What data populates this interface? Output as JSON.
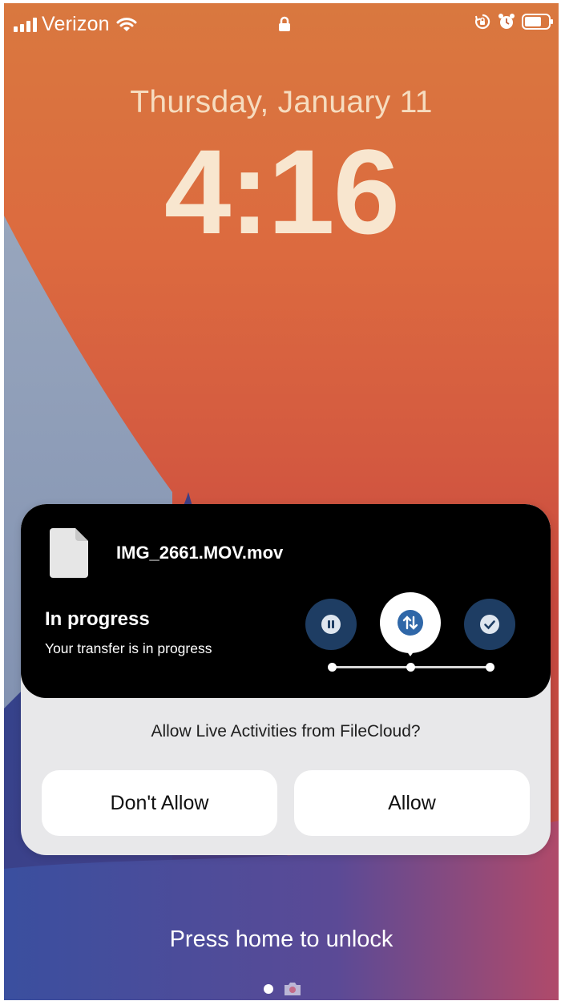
{
  "status_bar": {
    "carrier": "Verizon",
    "signal_bars": 4,
    "icons": [
      "signal-icon",
      "wifi-icon",
      "lock-icon",
      "rotation-lock-icon",
      "alarm-icon",
      "battery-icon"
    ]
  },
  "lock_screen": {
    "date": "Thursday, January 11",
    "time": "4:16",
    "unlock_hint": "Press home to unlock",
    "page_indicator": [
      "page-dot",
      "camera-icon"
    ]
  },
  "live_activity": {
    "filename": "IMG_2661.MOV.mov",
    "status_title": "In progress",
    "status_subtitle": "Your transfer is in progress",
    "steps": [
      {
        "name": "pause",
        "icon": "pause-icon",
        "active": false
      },
      {
        "name": "transfer",
        "icon": "transfer-arrows-icon",
        "active": true
      },
      {
        "name": "complete",
        "icon": "checkmark-icon",
        "active": false
      }
    ],
    "colors": {
      "step_bg": "#1e3d63",
      "step_icon": "#2f67a8",
      "card_bg": "#000000"
    }
  },
  "permission": {
    "prompt": "Allow Live Activities from FileCloud?",
    "deny_label": "Don't Allow",
    "allow_label": "Allow"
  }
}
